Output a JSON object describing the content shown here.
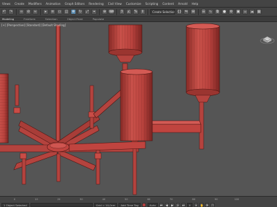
{
  "menubar": {
    "items": [
      "Views",
      "Create",
      "Modifiers",
      "Animation",
      "Graph Editors",
      "Rendering",
      "Civil View",
      "Customize",
      "Scripting",
      "Content",
      "Arnold",
      "Help"
    ]
  },
  "toolbar": {
    "selection_set_placeholder": "Create Selection Se"
  },
  "ribbon": {
    "tabs": [
      "Modeling",
      "Freeform",
      "Selection",
      "Object Paint",
      "Populate"
    ]
  },
  "viewport": {
    "label": "[+] [Perspective] [Standard] [Default Shading]"
  },
  "scene": {
    "colors": {
      "background": "#555555",
      "metal_red": "#c0443f",
      "metal_dark": "#7a2522",
      "wire": "#4a1512"
    }
  },
  "statusbar": {
    "timeline_ticks": [
      "0",
      "10",
      "20",
      "30",
      "40",
      "50",
      "60",
      "70",
      "80",
      "90",
      "100"
    ],
    "selected": "1 Object Selected",
    "grid": "Grid = 10,0cm",
    "frame": "0",
    "add_time_tag": "Add Time Tag",
    "mode": "Auto"
  }
}
